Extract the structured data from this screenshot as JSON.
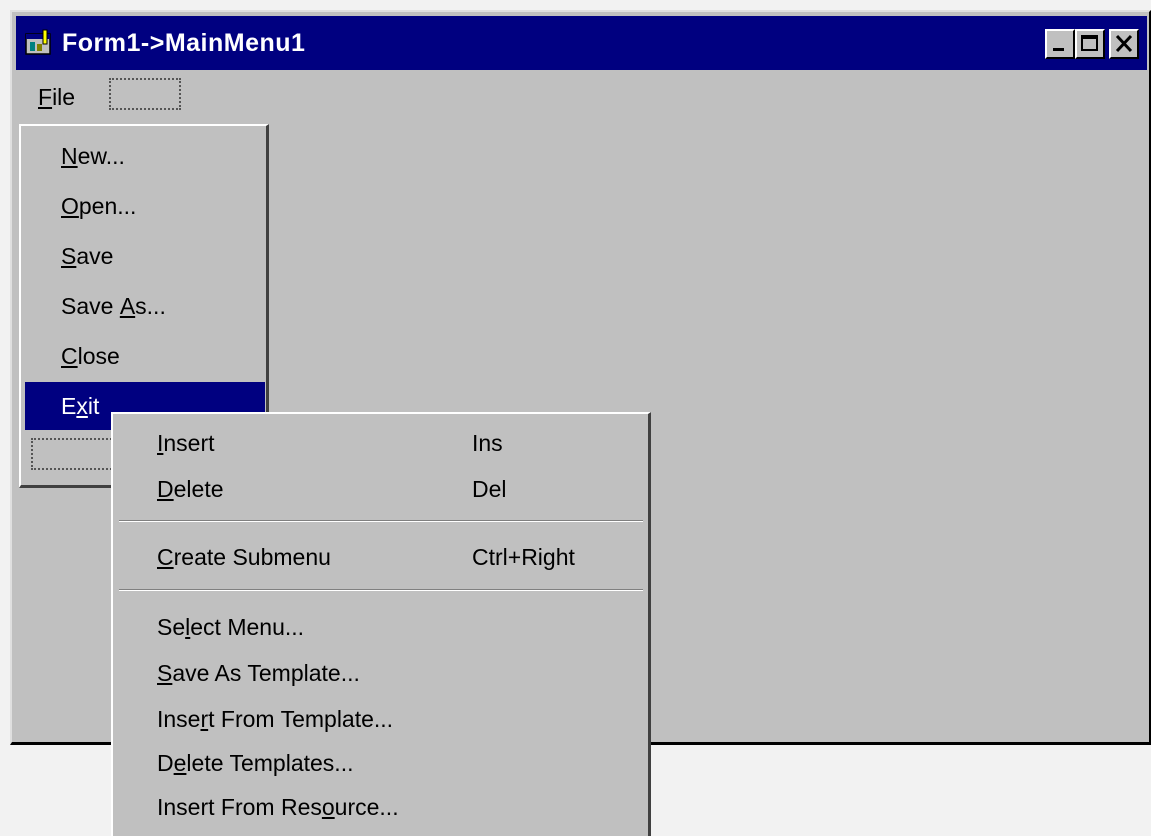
{
  "window": {
    "title": "Form1->MainMenu1",
    "colors": {
      "titlebar": "#000080",
      "face": "#c0c0c0",
      "highlight": "#000080"
    }
  },
  "menubar": {
    "items": [
      {
        "label": "File",
        "accel": "F",
        "rest": "ile"
      }
    ]
  },
  "file_menu": {
    "items": [
      {
        "label": "New...",
        "before": "",
        "accel": "N",
        "after": "ew..."
      },
      {
        "label": "Open...",
        "before": "",
        "accel": "O",
        "after": "pen..."
      },
      {
        "label": "Save",
        "before": "",
        "accel": "S",
        "after": "ave"
      },
      {
        "label": "Save As...",
        "before": "Save ",
        "accel": "A",
        "after": "s..."
      },
      {
        "label": "Close",
        "before": "",
        "accel": "C",
        "after": "lose"
      },
      {
        "label": "Exit",
        "before": "E",
        "accel": "x",
        "after": "it",
        "selected": true
      }
    ]
  },
  "context_menu": {
    "items": [
      {
        "label": "Insert",
        "before": "",
        "accel": "I",
        "after": "nsert",
        "shortcut": "Ins"
      },
      {
        "label": "Delete",
        "before": "",
        "accel": "D",
        "after": "elete",
        "shortcut": "Del"
      },
      {
        "label": "Create Submenu",
        "before": "",
        "accel": "C",
        "after": "reate Submenu",
        "shortcut": "Ctrl+Right"
      },
      {
        "label": "Select Menu...",
        "before": "Se",
        "accel": "l",
        "after": "ect Menu...",
        "shortcut": ""
      },
      {
        "label": "Save As Template...",
        "before": "",
        "accel": "S",
        "after": "ave As Template...",
        "shortcut": ""
      },
      {
        "label": "Insert From Template...",
        "before": "Inse",
        "accel": "r",
        "after": "t From Template...",
        "shortcut": ""
      },
      {
        "label": "Delete Templates...",
        "before": "D",
        "accel": "e",
        "after": "lete Templates...",
        "shortcut": ""
      },
      {
        "label": "Insert From Resource...",
        "before": "Insert From Res",
        "accel": "o",
        "after": "urce...",
        "shortcut": ""
      }
    ]
  },
  "icons": {
    "app": "form-app-icon",
    "minimize": "minimize-icon",
    "maximize": "maximize-icon",
    "close": "close-icon"
  }
}
